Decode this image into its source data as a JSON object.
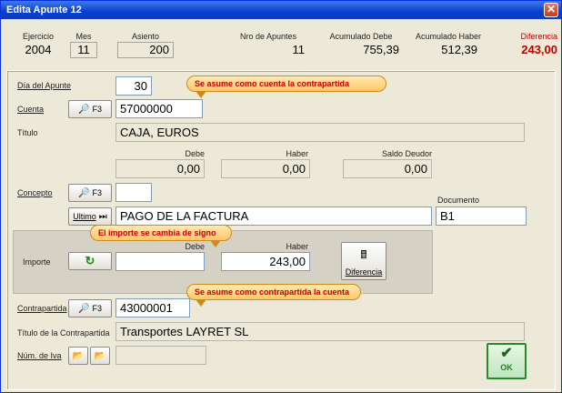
{
  "window": {
    "title": "Edita Apunte 12",
    "close_label": "✕"
  },
  "header": {
    "ejercicio_label": "Ejercicio",
    "ejercicio_value": "2004",
    "mes_label": "Mes",
    "mes_value": "11",
    "asiento_label": "Asiento",
    "asiento_value": "200",
    "nro_label": "Nro de Apuntes",
    "nro_value": "11",
    "debe_label": "Acumulado Debe",
    "debe_value": "755,39",
    "haber_label": "Acumulado Haber",
    "haber_value": "512,39",
    "dif_label": "Diferencia",
    "dif_value": "243,00"
  },
  "form": {
    "dia_label": "Día del Apunte",
    "dia_value": "30",
    "cuenta_label": "Cuenta",
    "cuenta_btn": "F3",
    "cuenta_value": "57000000",
    "titulo_label": "Título",
    "titulo_value": "CAJA, EUROS",
    "debe_hdr": "Debe",
    "haber_hdr": "Haber",
    "saldo_hdr": "Saldo Deudor",
    "debe_value": "0,00",
    "haber_value": "0,00",
    "saldo_value": "0,00",
    "concepto_label": "Concepto",
    "concepto_btn": "F3",
    "concepto_code": "",
    "ultimo_btn": "Ultimo",
    "concepto_text": "PAGO DE LA FACTURA",
    "documento_label": "Documento",
    "documento_value": "B1",
    "importe_label": "Importe",
    "importe_debe_label": "Debe",
    "importe_haber_label": "Haber",
    "importe_debe_value": "",
    "importe_haber_value": "243,00",
    "diferencia_btn": "Diferencia",
    "contrapartida_label": "Contrapartida",
    "contrapartida_btn": "F3",
    "contrapartida_value": "43000001",
    "titulo_contra_label": "Título de la Contrapartida",
    "titulo_contra_value": "Transportes LAYRET SL",
    "iva_label": "Núm. de Iva",
    "iva_value": "",
    "ok_label": "OK"
  },
  "tooltips": {
    "cuenta": "Se asume como cuenta la contrapartida",
    "importe": "El importe se cambia de signo",
    "contrapartida": "Se asume como contrapartida la cuenta"
  },
  "colors": {
    "diferencia": "#c00000",
    "tooltip_text": "#c20000",
    "title_bar": "#0a3fcf"
  }
}
